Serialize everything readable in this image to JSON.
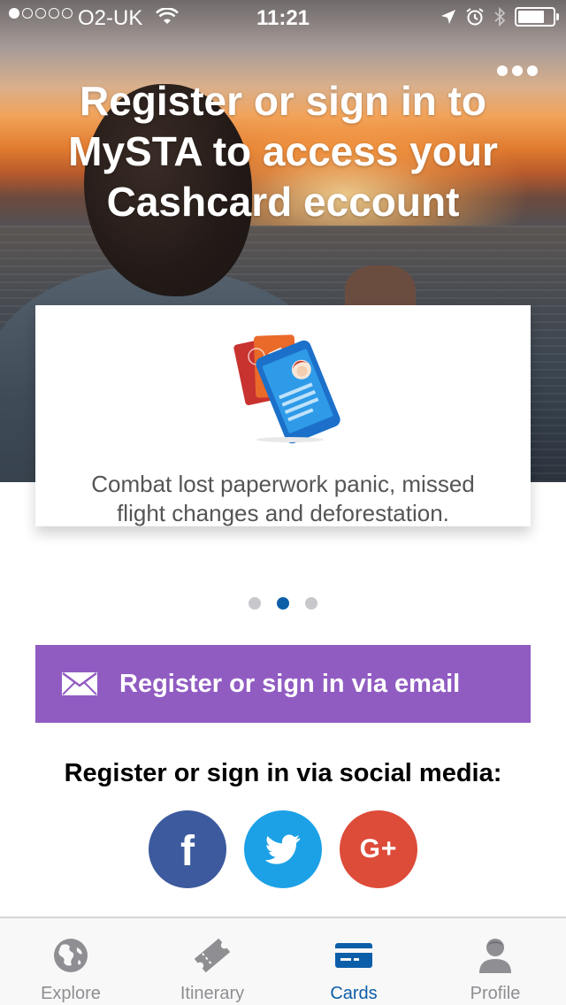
{
  "status_bar": {
    "carrier": "O2-UK",
    "time": "11:21",
    "signal_bars_filled": 1,
    "signal_bars_total": 5,
    "battery_level": 0.75,
    "icons": [
      "wifi-icon",
      "location-icon",
      "alarm-icon",
      "bluetooth-icon",
      "battery-icon"
    ]
  },
  "header": {
    "title": "Register or sign in to MySTA to access your Cashcard eccount",
    "more_icon": "more-dots-icon"
  },
  "carousel": {
    "illustration": "digital-documents-illustration",
    "text": "Combat lost paperwork panic, missed flight changes and deforestation.",
    "pages": 3,
    "active_page": 2
  },
  "email_button": {
    "label": "Register or sign in via email",
    "icon": "envelope-icon"
  },
  "social": {
    "heading": "Register or sign in via social media:",
    "buttons": [
      {
        "name": "facebook",
        "icon": "facebook-icon",
        "glyph": "f"
      },
      {
        "name": "twitter",
        "icon": "twitter-icon"
      },
      {
        "name": "google-plus",
        "icon": "google-plus-icon",
        "glyph": "G+"
      }
    ]
  },
  "tab_bar": {
    "tabs": [
      {
        "label": "Explore",
        "icon": "globe-icon"
      },
      {
        "label": "Itinerary",
        "icon": "ticket-icon"
      },
      {
        "label": "Cards",
        "icon": "card-icon"
      },
      {
        "label": "Profile",
        "icon": "person-icon"
      }
    ],
    "active_tab": "Cards"
  },
  "colors": {
    "accent_blue": "#0d5ea9",
    "email_purple": "#915cc2",
    "facebook": "#3c5a9d",
    "twitter": "#1da1e6",
    "google_plus": "#dd4b39",
    "tab_inactive": "#8e8e93"
  }
}
